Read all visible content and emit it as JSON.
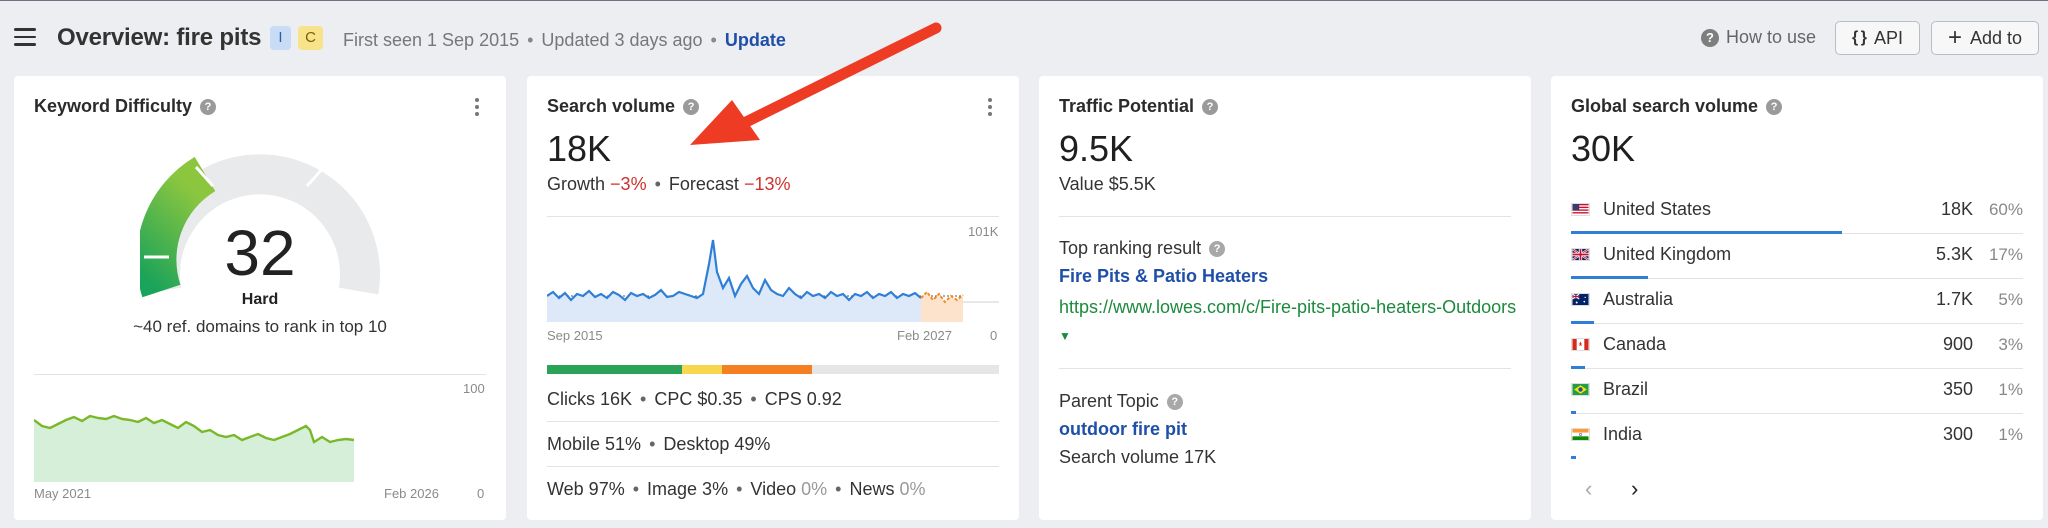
{
  "header": {
    "title": "Overview: fire pits",
    "badge_i": "I",
    "badge_c": "C",
    "first_seen": "First seen 1 Sep 2015",
    "updated": "Updated 3 days ago",
    "update_link": "Update",
    "how_to_use": "How to use",
    "api_label": "API",
    "add_to_label": "Add to"
  },
  "kd": {
    "title": "Keyword Difficulty",
    "value": "32",
    "level": "Hard",
    "description": "~40 ref. domains to rank in top 10",
    "chart_start": "May 2021",
    "chart_end": "Feb 2026",
    "chart_max": "100",
    "chart_min": "0"
  },
  "search_volume": {
    "title": "Search volume",
    "value": "18K",
    "growth_label": "Growth",
    "growth_value": "−3%",
    "forecast_label": "Forecast",
    "forecast_value": "−13%",
    "chart_start": "Sep 2015",
    "chart_end": "Feb 2027",
    "chart_max": "101K",
    "chart_min": "0",
    "clicks": "Clicks 16K",
    "cpc": "CPC $0.35",
    "cps": "CPS 0.92",
    "mobile": "Mobile 51%",
    "desktop": "Desktop 49%",
    "web": "Web 97%",
    "image": "Image 3%",
    "video_label": "Video",
    "video_value": "0%",
    "news_label": "News",
    "news_value": "0%"
  },
  "traffic_potential": {
    "title": "Traffic Potential",
    "value": "9.5K",
    "value_line": "Value $5.5K",
    "top_ranking_label": "Top ranking result",
    "top_ranking_title": "Fire Pits & Patio Heaters",
    "top_ranking_url": "https://www.lowes.com/c/Fire-pits-patio-heaters-Outdoors",
    "parent_topic_label": "Parent Topic",
    "parent_topic_link": "outdoor fire pit",
    "parent_topic_volume": "Search volume 17K"
  },
  "global_volume": {
    "title": "Global search volume",
    "value": "30K",
    "countries": [
      {
        "name": "United States",
        "volume": "18K",
        "pct": "60%",
        "share": 0.6
      },
      {
        "name": "United Kingdom",
        "volume": "5.3K",
        "pct": "17%",
        "share": 0.17
      },
      {
        "name": "Australia",
        "volume": "1.7K",
        "pct": "5%",
        "share": 0.05
      },
      {
        "name": "Canada",
        "volume": "900",
        "pct": "3%",
        "share": 0.03
      },
      {
        "name": "Brazil",
        "volume": "350",
        "pct": "1%",
        "share": 0.01
      },
      {
        "name": "India",
        "volume": "300",
        "pct": "1%",
        "share": 0.01
      }
    ],
    "prev_icon": "chevron-left-icon",
    "next_icon": "chevron-right-icon"
  },
  "colors": {
    "link": "#1f4fa8",
    "negative": "#d0312d",
    "url_green": "#1c8a3c",
    "bar_blue": "#2f7fd8",
    "arrow_red": "#ee3b24"
  }
}
